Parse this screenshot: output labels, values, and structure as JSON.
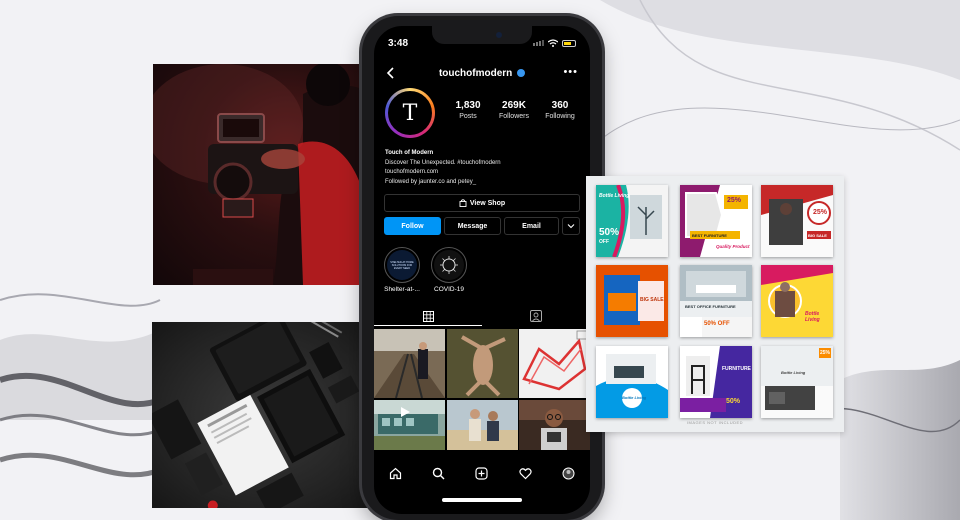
{
  "status_bar": {
    "time": "3:48"
  },
  "profile": {
    "username": "touchofmodern",
    "avatar_letter": "T",
    "stats": [
      {
        "value": "1,830",
        "label": "Posts"
      },
      {
        "value": "269K",
        "label": "Followers"
      },
      {
        "value": "360",
        "label": "Following"
      }
    ],
    "bio_name": "Touch of Modern",
    "bio_line1": "Discover The Unexpected. #touchofmodern",
    "bio_line2": "touchofmodern.com",
    "bio_followed_by": "Followed by jaunter.co and petey_"
  },
  "buttons": {
    "view_shop": "View Shop",
    "follow": "Follow",
    "message": "Message",
    "email": "Email"
  },
  "highlights": [
    {
      "label": "Shelter-at-...",
      "inner_text": "SHELTER-AT-HOME SOLUTIONS FOR EVERY NEED"
    },
    {
      "label": "COVID-19"
    }
  ],
  "posters": [
    {
      "line1": "Bottle Living",
      "line2": "50%",
      "line3": "OFF"
    },
    {
      "line1": "25%",
      "line2": "BEST FURNITURE",
      "line3": "Quality Product"
    },
    {
      "line1": "25%",
      "line2": "BIG SALE"
    },
    {
      "line1": "BIG SALE"
    },
    {
      "line1": "BEST OFFICE FURNITURE",
      "line2": "50% OFF"
    },
    {
      "line1": "Bottle Living"
    },
    {
      "line1": "Bottle Living"
    },
    {
      "line1": "FURNITURE",
      "line2": "50%"
    },
    {
      "line1": "Bottle Living",
      "line2": "25%"
    }
  ],
  "collage_caption": "IMAGES NOT INCLUDED"
}
